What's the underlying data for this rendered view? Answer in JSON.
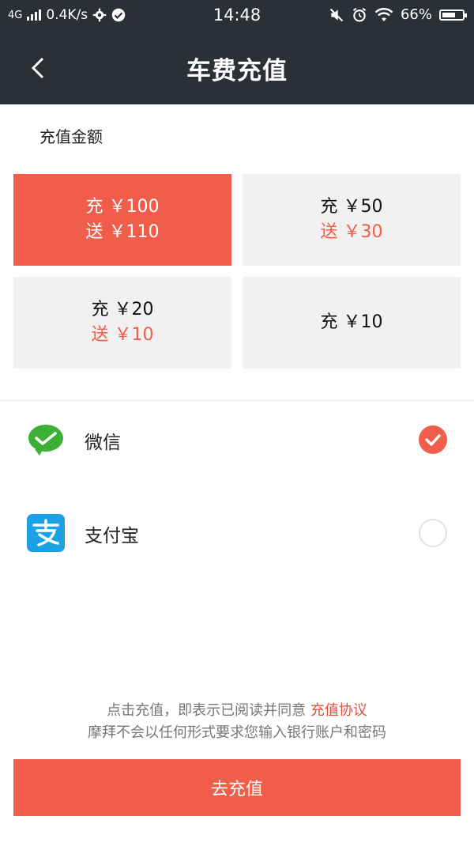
{
  "status_bar": {
    "network": "4G",
    "speed": "0.4K/s",
    "time": "14:48",
    "battery": "66%",
    "battery_level": 0.66
  },
  "header": {
    "title": "车费充值"
  },
  "amount_section": {
    "label": "充值金额"
  },
  "amounts": [
    {
      "charge": "充 ￥100",
      "bonus": "送 ￥110",
      "selected": true
    },
    {
      "charge": "充 ￥50",
      "bonus": "送 ￥30",
      "selected": false
    },
    {
      "charge": "充 ￥20",
      "bonus": "送 ￥10",
      "selected": false
    },
    {
      "charge": "充 ￥10",
      "bonus": "",
      "selected": false
    }
  ],
  "payment_methods": [
    {
      "label": "微信",
      "icon": "wechat-icon",
      "selected": true
    },
    {
      "label": "支付宝",
      "icon": "alipay-icon",
      "selected": false
    }
  ],
  "notice": {
    "line1_prefix": "点击充值，即表示已阅读并同意",
    "agreement_link": "充值协议",
    "line2": "摩拜不会以任何形式要求您输入银行账户和密码"
  },
  "submit_label": "去充值",
  "colors": {
    "accent": "#f05d4a",
    "header_bg": "#2b2f36",
    "wechat_green": "#3cb035",
    "alipay_blue": "#1aa1e6"
  }
}
